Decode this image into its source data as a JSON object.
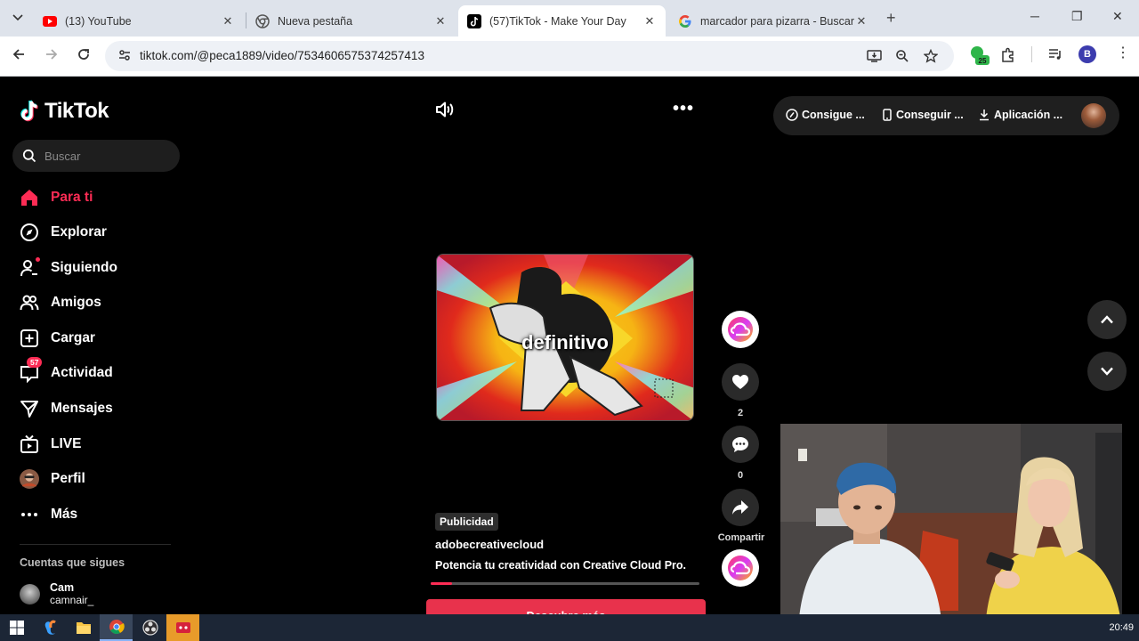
{
  "browser": {
    "tabs": [
      {
        "title": "(13) YouTube",
        "favicon": "youtube-icon",
        "active": false
      },
      {
        "title": "Nueva pestaña",
        "favicon": "chrome-icon",
        "active": false
      },
      {
        "title": "(57)TikTok - Make Your Day",
        "favicon": "tiktok-icon",
        "active": true
      },
      {
        "title": "marcador para pizarra - Buscar",
        "favicon": "google-icon",
        "active": false
      }
    ],
    "url": "tiktok.com/@peca1889/video/7534606575374257413",
    "extension_badge": "25",
    "profile_initial": "B"
  },
  "tiktok": {
    "logo_text": "TikTok",
    "search_placeholder": "Buscar",
    "nav": [
      {
        "label": "Para ti",
        "icon": "home-icon",
        "active": true
      },
      {
        "label": "Explorar",
        "icon": "compass-icon"
      },
      {
        "label": "Siguiendo",
        "icon": "following-icon"
      },
      {
        "label": "Amigos",
        "icon": "friends-icon"
      },
      {
        "label": "Cargar",
        "icon": "upload-icon"
      },
      {
        "label": "Actividad",
        "icon": "activity-icon",
        "badge": "57"
      },
      {
        "label": "Mensajes",
        "icon": "messages-icon"
      },
      {
        "label": "LIVE",
        "icon": "live-icon"
      },
      {
        "label": "Perfil",
        "icon": "profile-avatar"
      },
      {
        "label": "Más",
        "icon": "more-icon"
      }
    ],
    "following_heading": "Cuentas que sigues",
    "following_accounts": [
      {
        "name": "Cam",
        "username": "camnair_"
      }
    ],
    "top_actions": [
      {
        "label": "Consigue ...",
        "icon": "coins-icon"
      },
      {
        "label": "Conseguir ...",
        "icon": "phone-icon"
      },
      {
        "label": "Aplicación ...",
        "icon": "download-icon"
      }
    ],
    "video": {
      "overlay_text": "definitivo",
      "likes": "2",
      "comments": "0",
      "share_label": "Compartir",
      "ad_label": "Publicidad",
      "account": "adobecreativecloud",
      "description": "Potencia tu creatividad con Creative Cloud Pro.",
      "progress_fraction": 0.08,
      "cta_label": "Descubre más"
    }
  },
  "taskbar": {
    "clock": "20:49"
  },
  "colors": {
    "accent": "#fe2c55",
    "background": "#000000",
    "chrome_tabstrip": "#dee3eb"
  }
}
